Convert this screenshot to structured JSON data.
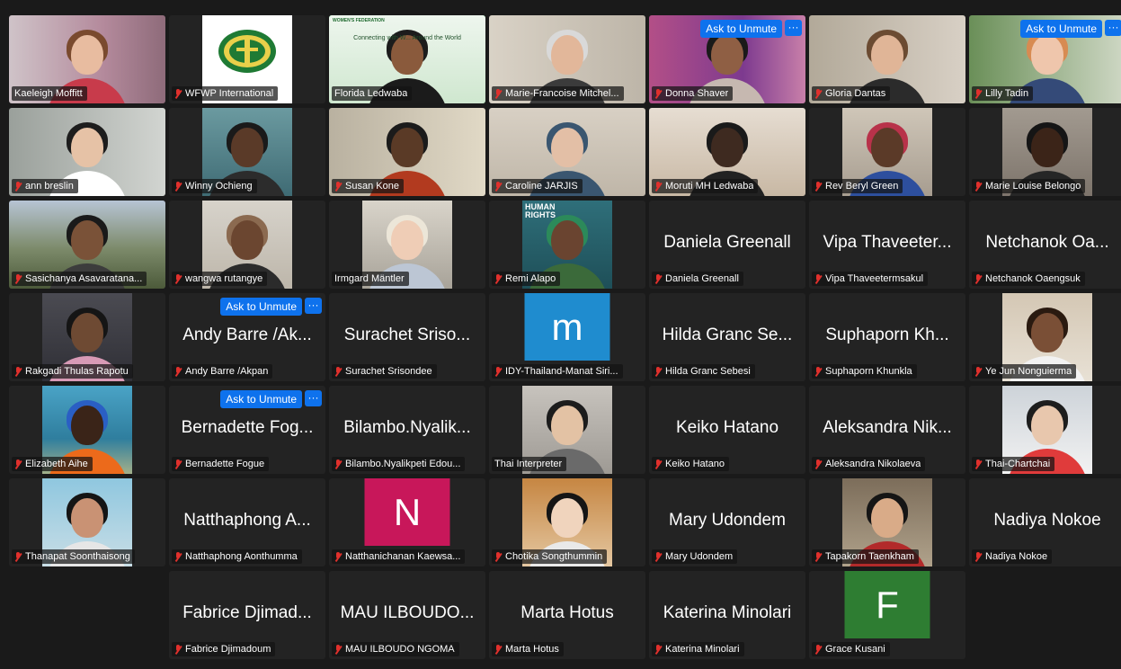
{
  "ui": {
    "ask_to_unmute": "Ask to Unmute",
    "more_glyph": "···"
  },
  "colors": {
    "tile_bg": "#232323",
    "active_speaker": "#23d959",
    "unmute_button": "#0e72ed",
    "muted_icon": "#e0302c"
  },
  "participants": [
    {
      "name": "Kaeleigh Moffitt",
      "muted": false
    },
    {
      "name": "WFWP International",
      "muted": true
    },
    {
      "name": "Florida Ledwaba",
      "muted": false,
      "active_speaker": true,
      "slide_header": "WOMEN'S FEDERATION",
      "slide_title": "Connecting with W... Around the World"
    },
    {
      "name": "Marie-Francoise Mitchel...",
      "muted": true
    },
    {
      "name": "Donna Shaver",
      "muted": true,
      "ask_to_unmute": true
    },
    {
      "name": "Gloria Dantas",
      "muted": true
    },
    {
      "name": "Lilly Tadin",
      "muted": true,
      "ask_to_unmute": true
    },
    {
      "name": "ann breslin",
      "muted": true
    },
    {
      "name": "Winny Ochieng",
      "muted": true
    },
    {
      "name": "Susan Kone",
      "muted": true
    },
    {
      "name": "Caroline JARJIS",
      "muted": true
    },
    {
      "name": "Moruti MH Ledwaba",
      "muted": true
    },
    {
      "name": "Rev Beryl Green",
      "muted": true
    },
    {
      "name": "Marie Louise Belongo",
      "muted": true
    },
    {
      "name": "Sasichanya Asavaratana...",
      "muted": true
    },
    {
      "name": "wangwa rutangye",
      "muted": true
    },
    {
      "name": "Irmgard Mäntler",
      "muted": false
    },
    {
      "name": "Remi Alapo",
      "muted": true,
      "video_text": "HUMAN RIGHTS"
    },
    {
      "name": "Daniela Greenall",
      "display": "Daniela Greenall",
      "muted": true
    },
    {
      "name": "Vipa Thaveetermsakul",
      "display": "Vipa Thaveeter...",
      "muted": true
    },
    {
      "name": "Netchanok Oaengsuk",
      "display": "Netchanok Oa...",
      "muted": true
    },
    {
      "name": "Rakgadi Thulas Rapotu",
      "muted": true
    },
    {
      "name": "Andy Barre /Akpan",
      "display": "Andy Barre /Ak...",
      "muted": true,
      "ask_to_unmute": true
    },
    {
      "name": "Surachet Srisondee",
      "display": "Surachet Sriso...",
      "muted": true
    },
    {
      "name": "IDY-Thailand-Manat Siri...",
      "initial": "m",
      "initial_color": "#1f8ccf",
      "muted": true
    },
    {
      "name": "Hilda Granc Sebesi",
      "display": "Hilda Granc Se...",
      "muted": true
    },
    {
      "name": "Suphaporn Khunkla",
      "display": "Suphaporn Kh...",
      "muted": true
    },
    {
      "name": "Ye Jun Nonguierma",
      "muted": true
    },
    {
      "name": "Elizabeth Aihe",
      "muted": true
    },
    {
      "name": "Bernadette Fogue",
      "display": "Bernadette Fog...",
      "muted": true,
      "ask_to_unmute": true
    },
    {
      "name": "Bilambo.Nyalikpeti Edou...",
      "display": "Bilambo.Nyalik...",
      "muted": true
    },
    {
      "name": "Thai Interpreter",
      "muted": false
    },
    {
      "name": "Keiko Hatano",
      "display": "Keiko Hatano",
      "muted": true
    },
    {
      "name": "Aleksandra Nikolaeva",
      "display": "Aleksandra Nik...",
      "muted": true
    },
    {
      "name": "Thai-Chartchai",
      "muted": true
    },
    {
      "name": "Thanapat Soonthaisong",
      "muted": true
    },
    {
      "name": "Natthaphong Aonthumma",
      "display": "Natthaphong A...",
      "muted": true
    },
    {
      "name": "Natthanichanan Kaewsa...",
      "initial": "N",
      "initial_color": "#c8175a",
      "muted": true
    },
    {
      "name": "Chotika Songthummin",
      "muted": true
    },
    {
      "name": "Mary Udondem",
      "display": "Mary Udondem",
      "muted": true
    },
    {
      "name": "Tapakorn Taenkham",
      "muted": true
    },
    {
      "name": "Nadiya Nokoe",
      "display": "Nadiya Nokoe",
      "muted": true
    },
    {
      "empty": true
    },
    {
      "name": "Fabrice Djimadoum",
      "display": "Fabrice Djimad...",
      "muted": true
    },
    {
      "name": "MAU ILBOUDO NGOMA",
      "display": "MAU ILBOUDO...",
      "muted": true
    },
    {
      "name": "Marta Hotus",
      "display": "Marta Hotus",
      "muted": true
    },
    {
      "name": "Katerina Minolari",
      "display": "Katerina Minolari",
      "muted": true
    },
    {
      "name": "Grace Kusani",
      "initial": "F",
      "initial_color": "#2e7d32",
      "muted": true
    }
  ]
}
